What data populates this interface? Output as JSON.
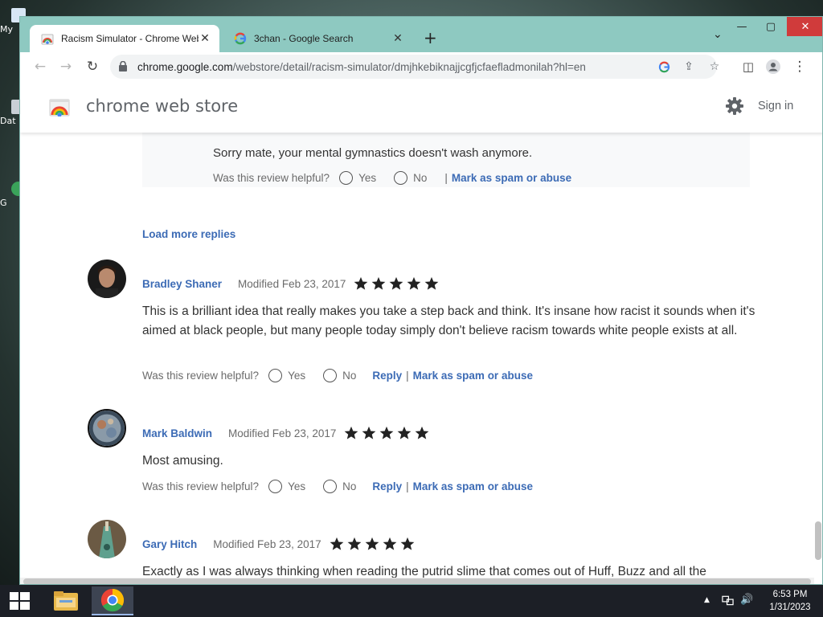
{
  "desktop": {
    "icons": [
      {
        "label": "My"
      },
      {
        "label": "Dat"
      },
      {
        "label": "G"
      }
    ]
  },
  "browser": {
    "tabs": [
      {
        "title": "Racism Simulator - Chrome Web Store",
        "active": true
      },
      {
        "title": "3chan - Google Search",
        "active": false
      }
    ],
    "url_host": "chrome.google.com",
    "url_path": "/webstore/detail/racism-simulator/dmjhkebiknajjcgfjcfaefladmonilah?hl=en"
  },
  "store": {
    "title": "chrome web store",
    "sign_in": "Sign in"
  },
  "reply": {
    "text": "Sorry mate, your mental gymnastics doesn't wash anymore.",
    "helpful_prompt": "Was this review helpful?",
    "yes": "Yes",
    "no": "No",
    "spam": "Mark as spam or abuse"
  },
  "load_more": "Load more replies",
  "common": {
    "helpful_prompt": "Was this review helpful?",
    "yes": "Yes",
    "no": "No",
    "reply": "Reply",
    "spam": "Mark as spam or abuse"
  },
  "reviews": [
    {
      "author": "Bradley Shaner",
      "date": "Modified Feb 23, 2017",
      "rating": 5,
      "body": "This is a brilliant idea that really makes you take a step back and think. It's insane how racist it sounds when it's aimed at black people, but many people today simply don't believe racism towards white people exists at all."
    },
    {
      "author": "Mark Baldwin",
      "date": "Modified Feb 23, 2017",
      "rating": 5,
      "body": "Most amusing."
    },
    {
      "author": "Gary Hitch",
      "date": "Modified Feb 23, 2017",
      "rating": 5,
      "body": "Exactly as I was always thinking when reading the putrid slime that comes out of Huff, Buzz and all the"
    }
  ],
  "taskbar": {
    "time": "6:53 PM",
    "date": "1/31/2023"
  },
  "colors": {
    "link": "#3c6bb5",
    "star": "#222222",
    "titlebar": "#8ec9c1"
  }
}
